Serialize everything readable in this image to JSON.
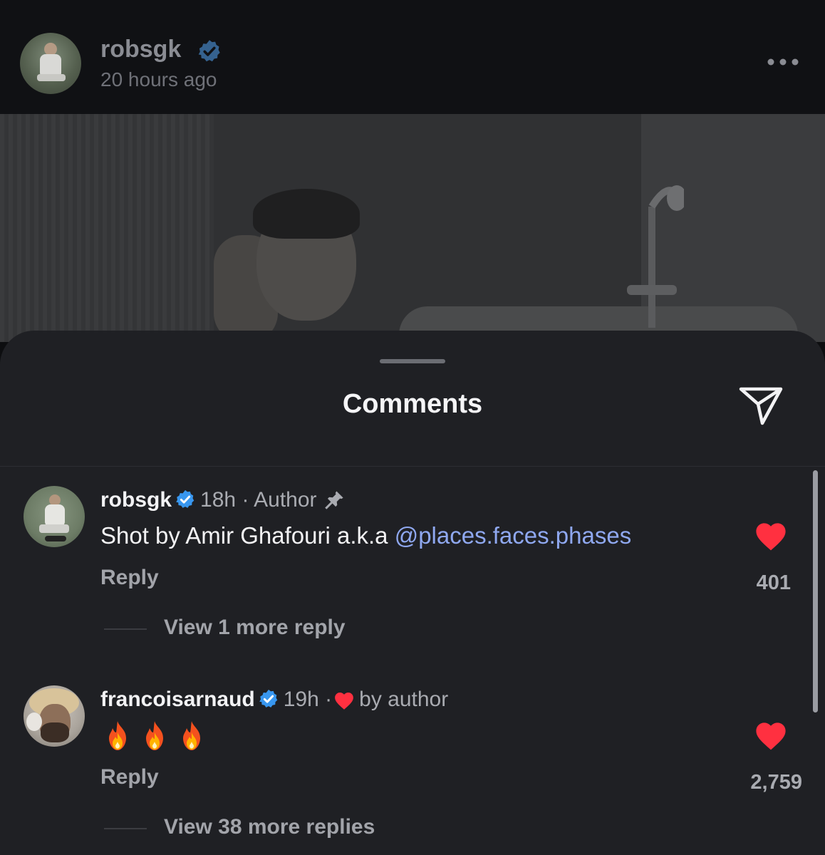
{
  "post": {
    "username": "robsgk",
    "time": "20 hours ago"
  },
  "sheet": {
    "title": "Comments"
  },
  "comments": [
    {
      "username": "robsgk",
      "time": "18h",
      "separator": "·",
      "badge": "Author",
      "text": "Shot by Amir Ghafouri a.k.a ",
      "mention": "@places.faces.phases",
      "reply_label": "Reply",
      "likes": "401",
      "more_replies": "View 1 more reply"
    },
    {
      "username": "francoisarnaud",
      "time": "19h",
      "separator": "·",
      "liked_by": "by author",
      "emoji": [
        "🔥",
        "🔥",
        "🔥"
      ],
      "reply_label": "Reply",
      "likes": "2,759",
      "more_replies": "View 38 more replies"
    }
  ],
  "colors": {
    "sheet_bg": "#1f2024",
    "accent_link": "#8fa8f0",
    "like_red": "#ff3040",
    "verified_blue": "#3897f0"
  },
  "icons": [
    "verified-badge-icon",
    "more-options-icon",
    "share-icon",
    "pin-icon",
    "heart-icon",
    "fire-emoji-icon"
  ]
}
